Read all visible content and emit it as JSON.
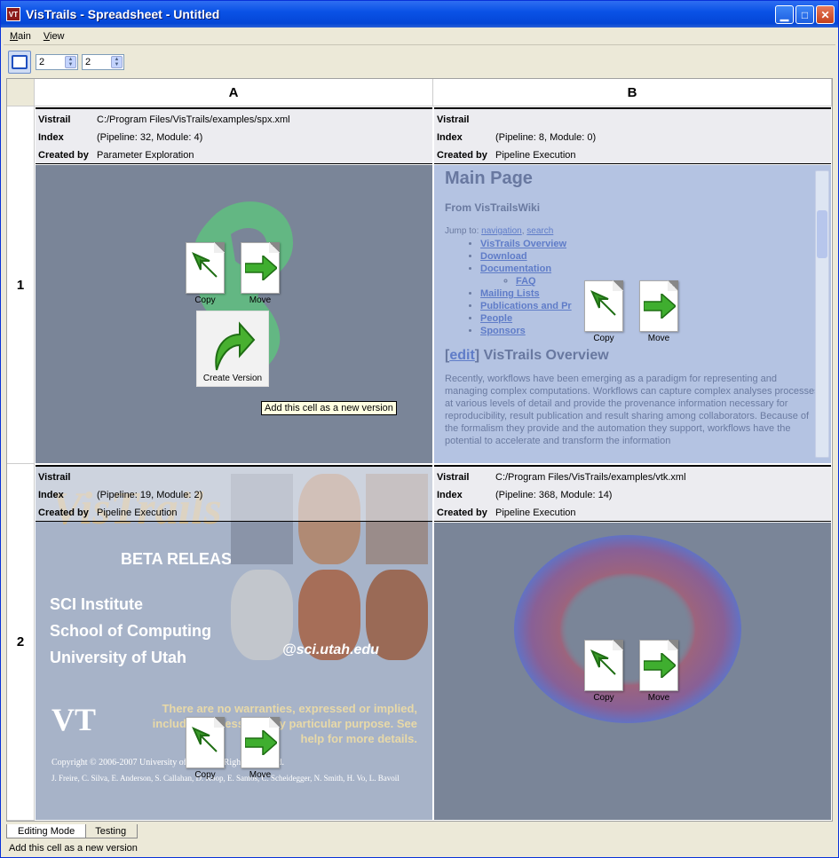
{
  "window": {
    "title": "VisTrails - Spreadsheet - Untitled",
    "app_icon": "vistrails-icon"
  },
  "menu": [
    "Main",
    "View"
  ],
  "toolbar": {
    "rows": "2",
    "cols": "2"
  },
  "grid": {
    "columns": [
      "A",
      "B"
    ],
    "rows": [
      "1",
      "2"
    ],
    "cells": {
      "a1": {
        "vistrail": "C:/Program Files/VisTrails/examples/spx.xml",
        "index": "(Pipeline: 32, Module: 4)",
        "created_by": "Parameter Exploration"
      },
      "b1": {
        "vistrail": "",
        "index": "(Pipeline: 8, Module: 0)",
        "created_by": "Pipeline Execution"
      },
      "a2": {
        "vistrail": "",
        "index": "(Pipeline: 19, Module: 2)",
        "created_by": "Pipeline Execution"
      },
      "b2": {
        "vistrail": "C:/Program Files/VisTrails/examples/vtk.xml",
        "index": "(Pipeline: 368, Module: 14)",
        "created_by": "Pipeline Execution"
      }
    },
    "info_labels": {
      "vistrail": "Vistrail",
      "index": "Index",
      "created_by": "Created by"
    }
  },
  "overlay": {
    "copy": "Copy",
    "move": "Move",
    "create_version": "Create Version",
    "tooltip": "Add this cell as a new version"
  },
  "wiki": {
    "title": "Main Page",
    "subtitle": "From VisTrailsWiki",
    "jump_prefix": "Jump to: ",
    "jump_nav": "navigation",
    "jump_sep": ", ",
    "jump_search": "search",
    "links": [
      "VisTrails Overview",
      "Download",
      "Documentation"
    ],
    "sub_link": "FAQ",
    "links2": [
      "Mailing Lists",
      "Publications and Pr",
      "People",
      "Sponsors"
    ],
    "edit": "edit",
    "section": "VisTrails Overview",
    "paragraph": "Recently, workflows have been emerging as a paradigm for representing and managing complex computations. Workflows can capture complex analyses processes at various levels of detail and provide the provenance information necessary for reproducibility, result publication and result sharing among collaborators. Because of the formalism they provide and the automation they support, workflows have the potential to accelerate and transform the information"
  },
  "splash": {
    "title": "VisTrails",
    "beta": "BETA RELEASE",
    "inst1": "SCI Institute",
    "inst2": "School of Computing",
    "inst3": "University of Utah",
    "email": "@sci.utah.edu",
    "warranty": "There are no warranties, expressed or implied, including fitness for any particular purpose. See help for more details.",
    "copyright": "Copyright © 2006-2007 University of Utah. All Rights Reserved.",
    "authors": "J. Freire, C. Silva, E. Anderson, S. Callahan, D. Koop, E. Santos, C. Scheidegger, N. Smith, H. Vo, L. Bavoil"
  },
  "tabs": [
    "Editing Mode",
    "Testing"
  ],
  "status": "Add this cell as a new version"
}
